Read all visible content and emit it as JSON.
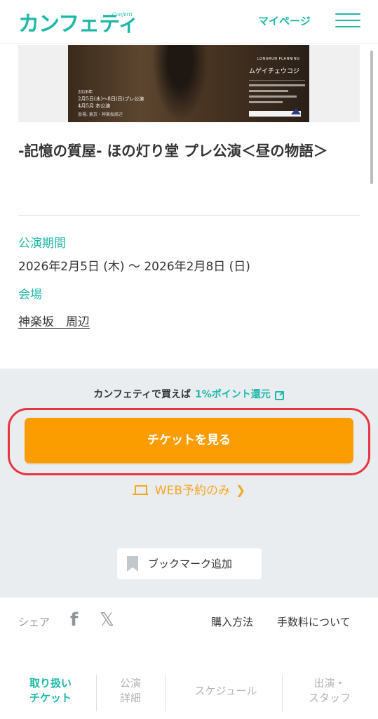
{
  "header": {
    "logo": "カンフェティ",
    "logo_sub": "Confetti",
    "mypage": "マイページ"
  },
  "banner": {
    "year": "2026年",
    "date_pre": "2月5日(木)〜8日(日)プレ公演",
    "date_main": "4月5月 本公演",
    "venue": "会場: 東京・神楽坂周辺",
    "brand": "LONGRUN PLANNING",
    "event_title": "ムゲイチェウコジ"
  },
  "event": {
    "title": "-記憶の質屋- ほの灯り堂 プレ公演＜昼の物語＞",
    "period_label": "公演期間",
    "period": "2026年2月5日 (木) 〜 2026年2月8日 (日)",
    "venue_label": "会場",
    "venue": "神楽坂　周辺"
  },
  "purchase": {
    "point_text": "カンフェティで買えば",
    "point_accent": "1%ポイント還元",
    "cta": "チケットを見る",
    "web_only": "WEB予約のみ",
    "bookmark": "ブックマーク追加"
  },
  "share": {
    "label": "シェア",
    "facebook": "f",
    "x": "𝕏",
    "buy_method": "購入方法",
    "fee": "手数料について"
  },
  "tabs": [
    {
      "label_1": "取り扱い",
      "label_2": "チケット"
    },
    {
      "label_1": "公演",
      "label_2": "詳細"
    },
    {
      "label_1": "スケジュール",
      "label_2": ""
    },
    {
      "label_1": "出演・",
      "label_2": "スタッフ"
    }
  ],
  "colors": {
    "brand": "#1fb8a8",
    "cta": "#fb9c00",
    "highlight_ring": "#e8343f",
    "web_only": "#f5a623"
  }
}
